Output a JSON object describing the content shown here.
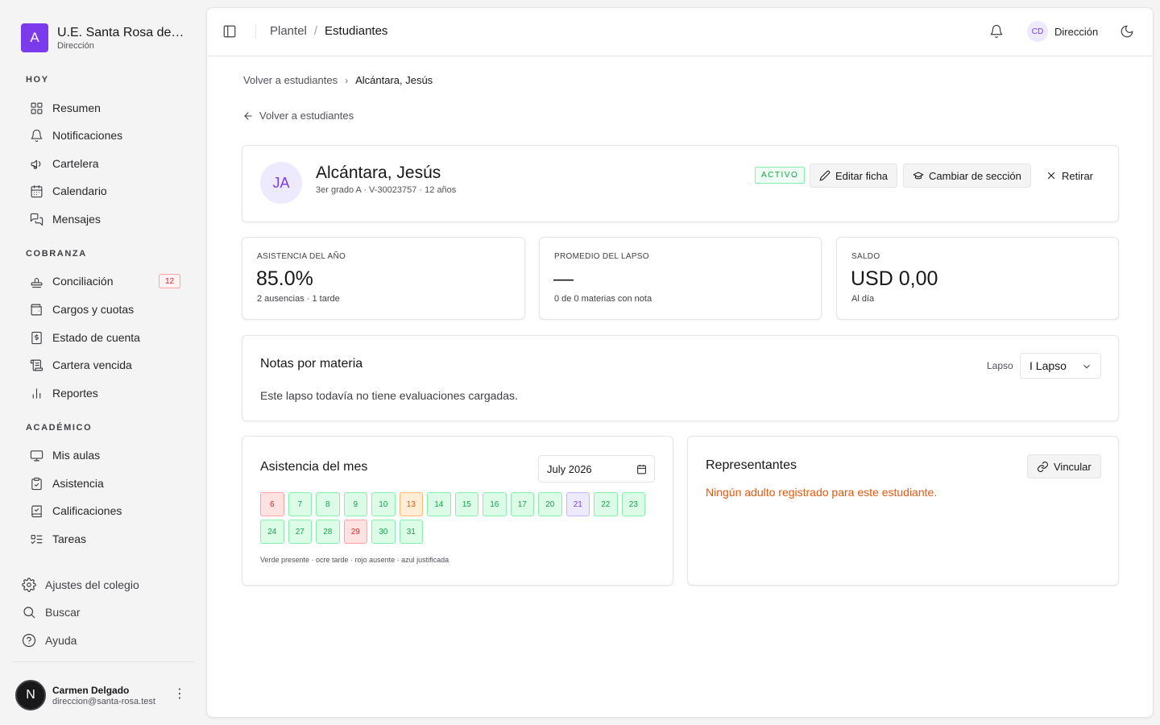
{
  "brand": {
    "initial": "A",
    "name": "U.E. Santa Rosa de Li...",
    "role": "Dirección"
  },
  "sidebar": {
    "groups": [
      {
        "label": "HOY",
        "items": [
          {
            "label": "Resumen",
            "icon": "grid-icon"
          },
          {
            "label": "Notificaciones",
            "icon": "bell-icon"
          },
          {
            "label": "Cartelera",
            "icon": "megaphone-icon"
          },
          {
            "label": "Calendario",
            "icon": "calendar-icon"
          },
          {
            "label": "Mensajes",
            "icon": "messages-icon"
          }
        ]
      },
      {
        "label": "COBRANZA",
        "items": [
          {
            "label": "Conciliación",
            "icon": "stamp-icon",
            "badge": "12"
          },
          {
            "label": "Cargos y cuotas",
            "icon": "wallet-icon"
          },
          {
            "label": "Estado de cuenta",
            "icon": "receipt-icon"
          },
          {
            "label": "Cartera vencida",
            "icon": "scroll-icon"
          },
          {
            "label": "Reportes",
            "icon": "bar-chart-icon"
          }
        ]
      },
      {
        "label": "ACADÉMICO",
        "items": [
          {
            "label": "Mis aulas",
            "icon": "monitor-icon"
          },
          {
            "label": "Asistencia",
            "icon": "clipboard-check-icon"
          },
          {
            "label": "Calificaciones",
            "icon": "book-check-icon"
          },
          {
            "label": "Tareas",
            "icon": "list-todo-icon"
          }
        ]
      }
    ],
    "bottom": [
      {
        "label": "Ajustes del colegio",
        "icon": "gear-icon"
      },
      {
        "label": "Buscar",
        "icon": "search-icon"
      },
      {
        "label": "Ayuda",
        "icon": "help-circle-icon"
      }
    ],
    "user": {
      "initial": "N",
      "name": "Carmen Delgado",
      "email": "direccion@santa-rosa.test",
      "menu": "⋮"
    }
  },
  "topbar": {
    "crumb_parent": "Plantel",
    "crumb_sep": "/",
    "crumb_current": "Estudiantes",
    "user_initials": "CD",
    "user_role": "Dirección"
  },
  "page": {
    "breadcrumb_parent": "Volver a estudiantes",
    "breadcrumb_current": "Alcántara, Jesús",
    "back_label": "Volver a estudiantes"
  },
  "student": {
    "initials": "JA",
    "name": "Alcántara, Jesús",
    "meta": "3er grado A · V-30023757 · 12 años",
    "status": "ACTIVO",
    "edit_label": "Editar ficha",
    "change_section_label": "Cambiar de sección",
    "withdraw_label": "Retirar"
  },
  "stats": [
    {
      "label": "ASISTENCIA DEL AÑO",
      "value": "85.0%",
      "sub": "2 ausencias · 1 tarde"
    },
    {
      "label": "PROMEDIO DEL LAPSO",
      "value": "—",
      "sub": "0 de 0 materias con nota"
    },
    {
      "label": "SALDO",
      "value": "USD 0,00",
      "sub": "Al día"
    }
  ],
  "notes": {
    "title": "Notas por materia",
    "lapso_label": "Lapso",
    "lapso_value": "I Lapso",
    "empty": "Este lapso todavía no tiene evaluaciones cargadas."
  },
  "attendance": {
    "title": "Asistencia del mes",
    "month_value": "July  2026",
    "days": [
      {
        "day": "6",
        "status": "absent"
      },
      {
        "day": "7",
        "status": "present"
      },
      {
        "day": "8",
        "status": "present"
      },
      {
        "day": "9",
        "status": "present"
      },
      {
        "day": "10",
        "status": "present"
      },
      {
        "day": "13",
        "status": "late"
      },
      {
        "day": "14",
        "status": "present"
      },
      {
        "day": "15",
        "status": "present"
      },
      {
        "day": "16",
        "status": "present"
      },
      {
        "day": "17",
        "status": "present"
      },
      {
        "day": "20",
        "status": "present"
      },
      {
        "day": "21",
        "status": "today"
      },
      {
        "day": "22",
        "status": "present"
      },
      {
        "day": "23",
        "status": "present"
      },
      {
        "day": "24",
        "status": "present"
      },
      {
        "day": "27",
        "status": "present"
      },
      {
        "day": "28",
        "status": "present"
      },
      {
        "day": "29",
        "status": "absent"
      },
      {
        "day": "30",
        "status": "present"
      },
      {
        "day": "31",
        "status": "present"
      }
    ],
    "legend": "Verde presente · ocre tarde · rojo ausente · azul justificada"
  },
  "guardians": {
    "title": "Representantes",
    "link_label": "Vincular",
    "empty": "Ningún adulto registrado para este estudiante."
  },
  "colors": {
    "accent": "#7c3aed",
    "present": "#16a34a",
    "late": "#ea580c",
    "absent": "#dc2626"
  }
}
